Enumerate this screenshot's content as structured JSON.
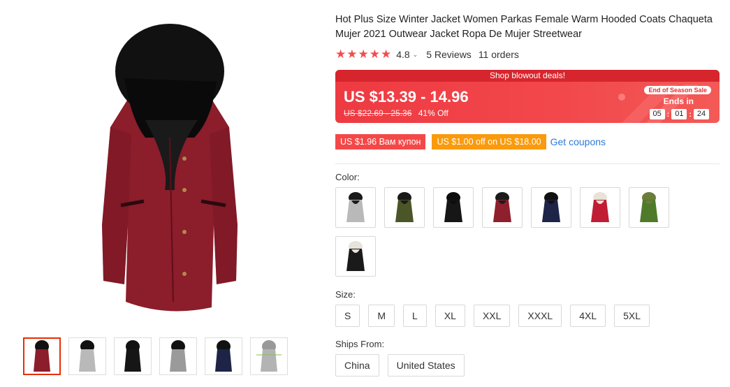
{
  "product": {
    "title": "Hot Plus Size Winter Jacket Women Parkas Female Warm Hooded Coats Chaqueta Mujer 2021 Outwear Jacket Ropa De Mujer Streetwear",
    "stars": "★★★★★",
    "score": "4.8",
    "reviews": "5 Reviews",
    "orders": "11 orders"
  },
  "deal": {
    "banner": "Shop blowout deals!",
    "price": "US $13.39 - 14.96",
    "old_price": "US $22.69 - 25.36",
    "discount": "41% Off",
    "season_badge": "End of Season Sale",
    "ends_label": "Ends in",
    "timer": [
      "05",
      "01",
      "24"
    ]
  },
  "coupons": {
    "coupon1": "US $1.96 Вам купон",
    "coupon2": "US $1.00 off on US $18.00",
    "get_link": "Get coupons"
  },
  "color": {
    "label": "Color:",
    "options": [
      {
        "coat": "#b9b9b9",
        "hood": "#1a1a1a"
      },
      {
        "coat": "#4a5528",
        "hood": "#1a1a1a"
      },
      {
        "coat": "#161616",
        "hood": "#0d0d0d"
      },
      {
        "coat": "#8e1f2c",
        "hood": "#1a1a1a"
      },
      {
        "coat": "#1d2447",
        "hood": "#111111"
      },
      {
        "coat": "#c01c33",
        "hood": "#e9e2d6"
      },
      {
        "coat": "#4f7a2a",
        "hood": "#6b7d3a"
      },
      {
        "coat": "#1a1a1a",
        "hood": "#e8e3da"
      }
    ]
  },
  "size": {
    "label": "Size:",
    "options": [
      "S",
      "M",
      "L",
      "XL",
      "XXL",
      "XXXL",
      "4XL",
      "5XL"
    ]
  },
  "ships": {
    "label": "Ships From:",
    "options": [
      "China",
      "United States"
    ]
  },
  "gallery": {
    "main_coat_color": "#8c1d2b",
    "thumb_colors": [
      "#8c1d2b",
      "#b9b9b9",
      "#161616",
      "#9a9a9a",
      "#1d2447",
      "#b3b3b3"
    ]
  }
}
